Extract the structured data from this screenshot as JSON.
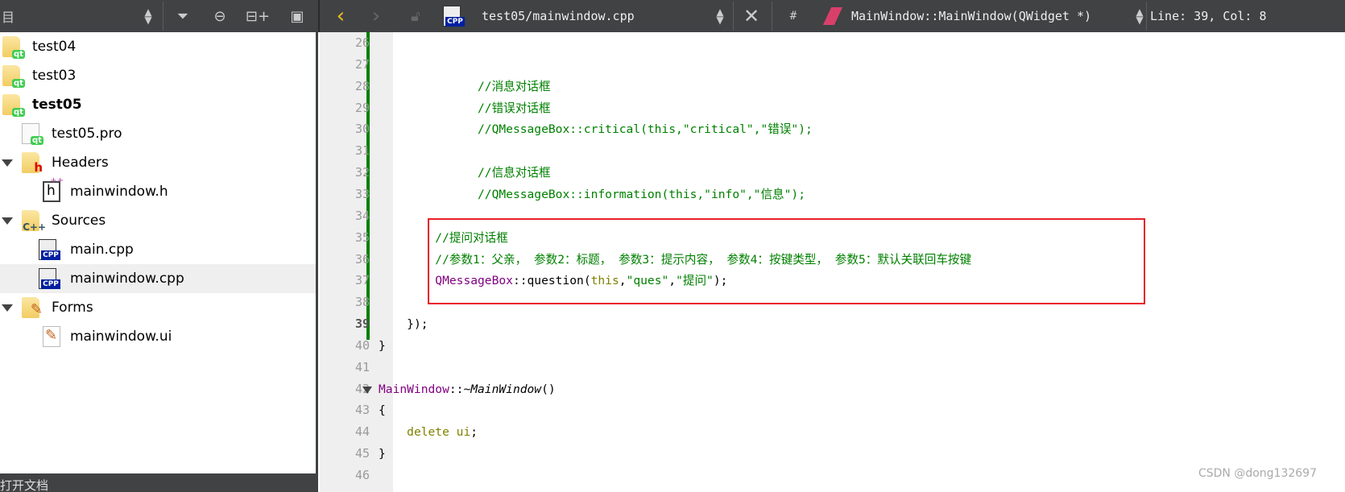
{
  "toolbar": {
    "left_label": "目",
    "file_name": "test05/mainwindow.cpp",
    "hash_label": "#",
    "function_name": "MainWindow::MainWindow(QWidget *)",
    "cursor_position": "Line: 39, Col: 8"
  },
  "tree": {
    "items": [
      {
        "label": "test04",
        "type": "project"
      },
      {
        "label": "test03",
        "type": "project"
      },
      {
        "label": "test05",
        "type": "project",
        "active": true
      },
      {
        "label": "test05.pro",
        "type": "pro"
      },
      {
        "label": "Headers",
        "type": "folder-h",
        "expanded": true
      },
      {
        "label": "mainwindow.h",
        "type": "header"
      },
      {
        "label": "Sources",
        "type": "folder-cpp",
        "expanded": true
      },
      {
        "label": "main.cpp",
        "type": "cpp"
      },
      {
        "label": "mainwindow.cpp",
        "type": "cpp",
        "selected": true
      },
      {
        "label": "Forms",
        "type": "folder-ui",
        "expanded": true
      },
      {
        "label": "mainwindow.ui",
        "type": "ui"
      }
    ],
    "badge_qt": "qt",
    "badge_cpp": "CPP"
  },
  "bottom_panel": {
    "label": "打开文档"
  },
  "editor": {
    "current_line": 39,
    "lines": [
      {
        "n": "26",
        "indent": 0,
        "segs": []
      },
      {
        "n": "27",
        "indent": 0,
        "segs": []
      },
      {
        "n": "28",
        "indent": 14,
        "segs": [
          {
            "t": "//消息对话框",
            "c": "comment"
          }
        ]
      },
      {
        "n": "29",
        "indent": 14,
        "segs": [
          {
            "t": "//错误对话框",
            "c": "comment"
          }
        ]
      },
      {
        "n": "30",
        "indent": 14,
        "segs": [
          {
            "t": "//QMessageBox::critical(this,\"critical\",\"错误\");",
            "c": "comment"
          }
        ]
      },
      {
        "n": "31",
        "indent": 0,
        "segs": []
      },
      {
        "n": "32",
        "indent": 14,
        "segs": [
          {
            "t": "//信息对话框",
            "c": "comment"
          }
        ]
      },
      {
        "n": "33",
        "indent": 14,
        "segs": [
          {
            "t": "//QMessageBox::information(this,\"info\",\"信息\");",
            "c": "comment"
          }
        ]
      },
      {
        "n": "34",
        "indent": 0,
        "segs": []
      },
      {
        "n": "35",
        "indent": 8,
        "segs": [
          {
            "t": "//提问对话框",
            "c": "comment"
          }
        ]
      },
      {
        "n": "36",
        "indent": 8,
        "segs": [
          {
            "t": "//参数1：父亲， 参数2：标题， 参数3：提示内容， 参数4：按键类型， 参数5：默认关联回车按键",
            "c": "comment"
          }
        ]
      },
      {
        "n": "37",
        "indent": 8,
        "segs": [
          {
            "t": "QMessageBox",
            "c": "type"
          },
          {
            "t": "::question(",
            "c": ""
          },
          {
            "t": "this",
            "c": "kw"
          },
          {
            "t": ",",
            "c": ""
          },
          {
            "t": "\"ques\"",
            "c": "string"
          },
          {
            "t": ",",
            "c": ""
          },
          {
            "t": "\"提问\"",
            "c": "string"
          },
          {
            "t": ");",
            "c": ""
          }
        ]
      },
      {
        "n": "38",
        "indent": 0,
        "segs": []
      },
      {
        "n": "39",
        "indent": 4,
        "segs": [
          {
            "t": "});",
            "c": ""
          }
        ]
      },
      {
        "n": "40",
        "indent": 0,
        "segs": [
          {
            "t": "}",
            "c": ""
          }
        ]
      },
      {
        "n": "41",
        "indent": 0,
        "segs": []
      },
      {
        "n": "42",
        "indent": 0,
        "fold": true,
        "segs": [
          {
            "t": "MainWindow",
            "c": "type"
          },
          {
            "t": "::~",
            "c": ""
          },
          {
            "t": "MainWindow",
            "c": "italic"
          },
          {
            "t": "()",
            "c": ""
          }
        ]
      },
      {
        "n": "43",
        "indent": 0,
        "segs": [
          {
            "t": "{",
            "c": ""
          }
        ]
      },
      {
        "n": "44",
        "indent": 4,
        "segs": [
          {
            "t": "delete",
            "c": "kw"
          },
          {
            "t": " ",
            "c": ""
          },
          {
            "t": "ui",
            "c": "kw"
          },
          {
            "t": ";",
            "c": ""
          }
        ]
      },
      {
        "n": "45",
        "indent": 0,
        "segs": [
          {
            "t": "}",
            "c": ""
          }
        ]
      },
      {
        "n": "46",
        "indent": 0,
        "segs": []
      }
    ]
  },
  "highlight_box_color": "#e8202a",
  "watermark": "CSDN @dong132697"
}
